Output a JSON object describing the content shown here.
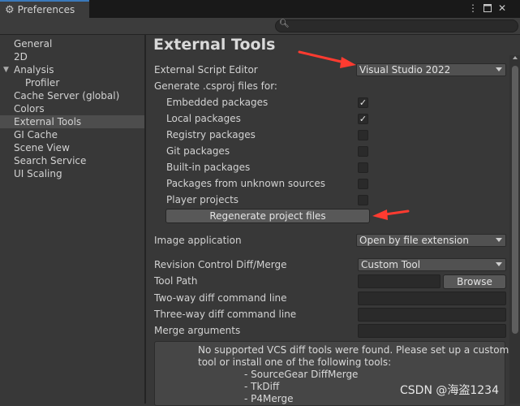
{
  "window": {
    "tab_title": "Preferences",
    "menu_icon": "kebab-menu-icon",
    "maximize_icon": "maximize-icon",
    "close_icon": "close-icon",
    "search_icon": "search-icon",
    "search_value": ""
  },
  "sidebar": {
    "items": [
      {
        "label": "General",
        "selected": false
      },
      {
        "label": "2D",
        "selected": false
      },
      {
        "label": "Analysis",
        "selected": false,
        "expanded": true
      },
      {
        "label": "Profiler",
        "selected": false,
        "child": true
      },
      {
        "label": "Cache Server (global)",
        "selected": false
      },
      {
        "label": "Colors",
        "selected": false
      },
      {
        "label": "External Tools",
        "selected": true
      },
      {
        "label": "GI Cache",
        "selected": false
      },
      {
        "label": "Scene View",
        "selected": false
      },
      {
        "label": "Search Service",
        "selected": false
      },
      {
        "label": "UI Scaling",
        "selected": false
      }
    ]
  },
  "main": {
    "title": "External Tools",
    "script_editor": {
      "label": "External Script Editor",
      "value": "Visual Studio 2022"
    },
    "generate_label": "Generate .csproj files for:",
    "packages": [
      {
        "label": "Embedded packages",
        "checked": true
      },
      {
        "label": "Local packages",
        "checked": true
      },
      {
        "label": "Registry packages",
        "checked": false
      },
      {
        "label": "Git packages",
        "checked": false
      },
      {
        "label": "Built-in packages",
        "checked": false
      },
      {
        "label": "Packages from unknown sources",
        "checked": false
      },
      {
        "label": "Player projects",
        "checked": false
      }
    ],
    "regenerate_button": "Regenerate project files",
    "image_application": {
      "label": "Image application",
      "value": "Open by file extension"
    },
    "revision_control": {
      "label": "Revision Control Diff/Merge",
      "value": "Custom Tool"
    },
    "tool_path": {
      "label": "Tool Path",
      "value": "",
      "browse_label": "Browse"
    },
    "two_way": {
      "label": "Two-way diff command line",
      "value": ""
    },
    "three_way": {
      "label": "Three-way diff command line",
      "value": ""
    },
    "merge_args": {
      "label": "Merge arguments",
      "value": ""
    },
    "help_lines": [
      "No supported VCS diff tools were found. Please set up a custom",
      "tool or install one of the following tools:",
      "- SourceGear DiffMerge",
      "- TkDiff",
      "- P4Merge"
    ]
  },
  "annotation_color": "#ff3b30",
  "watermark": "CSDN @海盗1234"
}
